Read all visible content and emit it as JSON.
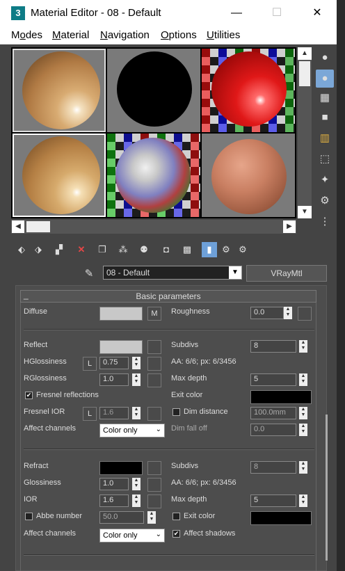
{
  "window": {
    "title": "Material Editor - 08 - Default",
    "minimize": "—",
    "maximize": "☐",
    "close": "✕",
    "app_icon": "3"
  },
  "menu": [
    "Modes",
    "Material",
    "Navigation",
    "Options",
    "Utilities"
  ],
  "material": {
    "name": "08 - Default",
    "type": "VRayMtl"
  },
  "rollout": {
    "title": "Basic parameters",
    "collapse": "_"
  },
  "params": {
    "diffuse": {
      "label": "Diffuse",
      "map_btn": "M"
    },
    "roughness": {
      "label": "Roughness",
      "value": "0.0"
    },
    "reflect": {
      "label": "Reflect"
    },
    "subdivs1": {
      "label": "Subdivs",
      "value": "8"
    },
    "hglossiness": {
      "label": "HGlossiness",
      "lock": "L",
      "value": "0.75"
    },
    "aa1": "AA: 6/6; px: 6/3456",
    "rglossiness": {
      "label": "RGlossiness",
      "value": "1.0"
    },
    "maxdepth1": {
      "label": "Max depth",
      "value": "5"
    },
    "fresnel": {
      "label": "Fresnel reflections",
      "checked": true
    },
    "exitcolor1": {
      "label": "Exit color"
    },
    "fresnel_ior": {
      "label": "Fresnel IOR",
      "lock": "L",
      "value": "1.6"
    },
    "dimdistance": {
      "label": "Dim distance",
      "checked": false,
      "value": "100.0mm"
    },
    "affect1": {
      "label": "Affect channels",
      "value": "Color only"
    },
    "dimfalloff": {
      "label": "Dim fall off",
      "value": "0.0"
    },
    "refract": {
      "label": "Refract"
    },
    "subdivs2": {
      "label": "Subdivs",
      "value": "8"
    },
    "glossiness": {
      "label": "Glossiness",
      "value": "1.0"
    },
    "aa2": "AA: 6/6; px: 6/3456",
    "ior": {
      "label": "IOR",
      "value": "1.6"
    },
    "maxdepth2": {
      "label": "Max depth",
      "value": "5"
    },
    "abbe": {
      "label": "Abbe number",
      "checked": false,
      "value": "50.0"
    },
    "exitcolor2": {
      "label": "Exit color",
      "checked": false
    },
    "affect2": {
      "label": "Affect channels",
      "value": "Color only"
    },
    "affectshadows": {
      "label": "Affect shadows",
      "checked": true
    }
  },
  "colors": {
    "diffuse": "#c8c8c8",
    "reflect": "#c8c8c8",
    "refract": "#000000",
    "exit": "#000000",
    "accent": "#6ea0d8"
  },
  "icons": {
    "side": [
      "sample-sphere-icon",
      "backlight-icon",
      "background-checker-icon",
      "uv-tiling-icon",
      "video-color-check-icon",
      "make-preview-icon",
      "sample-options-icon",
      "select-by-material-icon",
      "material-map-navigator-icon"
    ],
    "toolbar": [
      "get-material-icon",
      "put-to-scene-icon",
      "assign-to-selection-icon",
      "reset-map-icon",
      "make-copy-icon",
      "make-unique-icon",
      "put-to-library-icon",
      "material-id-channel-icon",
      "show-map-icon",
      "show-end-result-icon",
      "go-to-parent-icon",
      "go-forward-sibling-icon"
    ],
    "eyedropper": "pick-material-icon"
  }
}
